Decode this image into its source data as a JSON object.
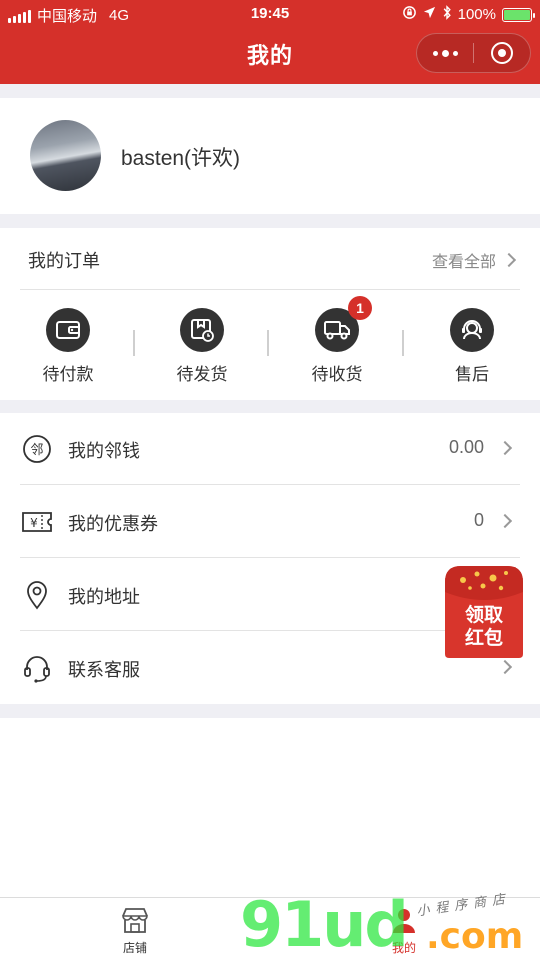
{
  "status_bar": {
    "carrier": "中国移动",
    "network": "4G",
    "time": "19:45",
    "battery": "100%",
    "battery_level": 1.0
  },
  "nav": {
    "title": "我的"
  },
  "profile": {
    "username": "basten(许欢)"
  },
  "orders": {
    "title": "我的订单",
    "view_all": "查看全部",
    "statuses": [
      {
        "label": "待付款",
        "icon": "wallet-icon"
      },
      {
        "label": "待发货",
        "icon": "package-clock-icon"
      },
      {
        "label": "待收货",
        "icon": "truck-icon",
        "badge": "1"
      },
      {
        "label": "售后",
        "icon": "headset-person-icon"
      }
    ]
  },
  "menu": [
    {
      "label": "我的邻钱",
      "value": "0.00",
      "icon": "neighbor-coin-icon"
    },
    {
      "label": "我的优惠券",
      "value": "0",
      "icon": "coupon-icon"
    },
    {
      "label": "我的地址",
      "value": "",
      "icon": "location-pin-icon"
    },
    {
      "label": "联系客服",
      "value": "",
      "icon": "headset-icon"
    }
  ],
  "red_packet": {
    "line1": "领取",
    "line2": "红包"
  },
  "tabbar": {
    "tabs": [
      {
        "label": "店铺",
        "icon": "shop-icon"
      },
      {
        "label": "我的",
        "icon": "person-icon",
        "active": true
      }
    ]
  },
  "watermark": {
    "main": "91ud",
    "domain": ".com",
    "tagline": "小程序商店"
  },
  "colors": {
    "brand_red": "#d5302a",
    "background_gap": "#efeff4",
    "icon_dark": "#333333"
  }
}
